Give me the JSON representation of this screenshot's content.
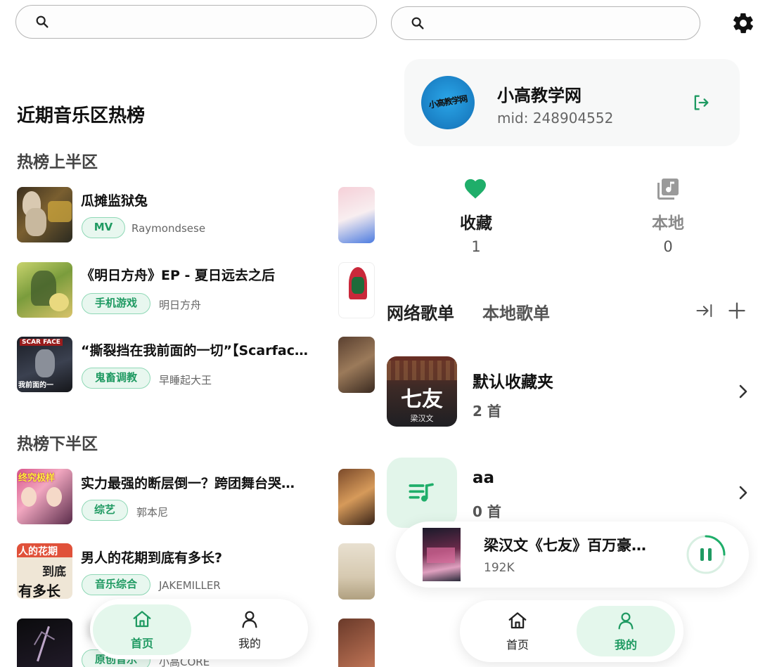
{
  "left": {
    "search": {
      "placeholder": ""
    },
    "heading": "近期音乐区热榜",
    "section_top": "热榜上半区",
    "section_bottom": "热榜下半区",
    "top_items": [
      {
        "title": "瓜摊监狱兔",
        "tag": "MV",
        "author": "Raymondsese"
      },
      {
        "title": "《明日方舟》EP - 夏日远去之后",
        "tag": "手机游戏",
        "author": "明日方舟"
      },
      {
        "title": "“撕裂挡在我前面的一切”【Scarface…",
        "tag": "鬼畜调教",
        "author": "早睡起大王"
      }
    ],
    "bottom_items": [
      {
        "title": "实力最强的断层倒一？跨团舞台哭…",
        "tag": "综艺",
        "author": "郭本尼"
      },
      {
        "title": "男人的花期到底有多长?",
        "tag": "音乐综合",
        "author": "JAKEMILLER"
      },
      {
        "title": "",
        "tag": "原创音乐",
        "author": "小高CORE"
      }
    ],
    "thumb_texts": {
      "scarface_1": "SCAR FACE",
      "scarface_2": "我前面的一",
      "flower_1": "人的花期",
      "flower_2": "到底",
      "flower_3": "有多长",
      "variety": "终究极样"
    },
    "nav": {
      "home": "首页",
      "mine": "我的"
    }
  },
  "right": {
    "search": {
      "placeholder": ""
    },
    "profile": {
      "name": "小高教学网",
      "mid": "mid: 248904552",
      "avatar_text": "小高教学网"
    },
    "stats": [
      {
        "label": "收藏",
        "value": "1",
        "icon": "heart-icon"
      },
      {
        "label": "本地",
        "value": "0",
        "icon": "music-library-icon"
      }
    ],
    "tabs": {
      "online": "网络歌单",
      "local": "本地歌单"
    },
    "playlists": [
      {
        "name": "默认收藏夹",
        "count": "2 首",
        "cover_text": "七友",
        "cover_sub": "梁汉文"
      },
      {
        "name": "aa",
        "count": "0 首"
      }
    ],
    "player": {
      "title": "梁汉文《七友》百万豪…",
      "plays": "192K"
    },
    "nav": {
      "home": "首页",
      "mine": "我的"
    }
  },
  "colors": {
    "accent": "#1f9a62",
    "accent_bg": "#e4f7ec",
    "tag_border": "#8fd8b6"
  }
}
